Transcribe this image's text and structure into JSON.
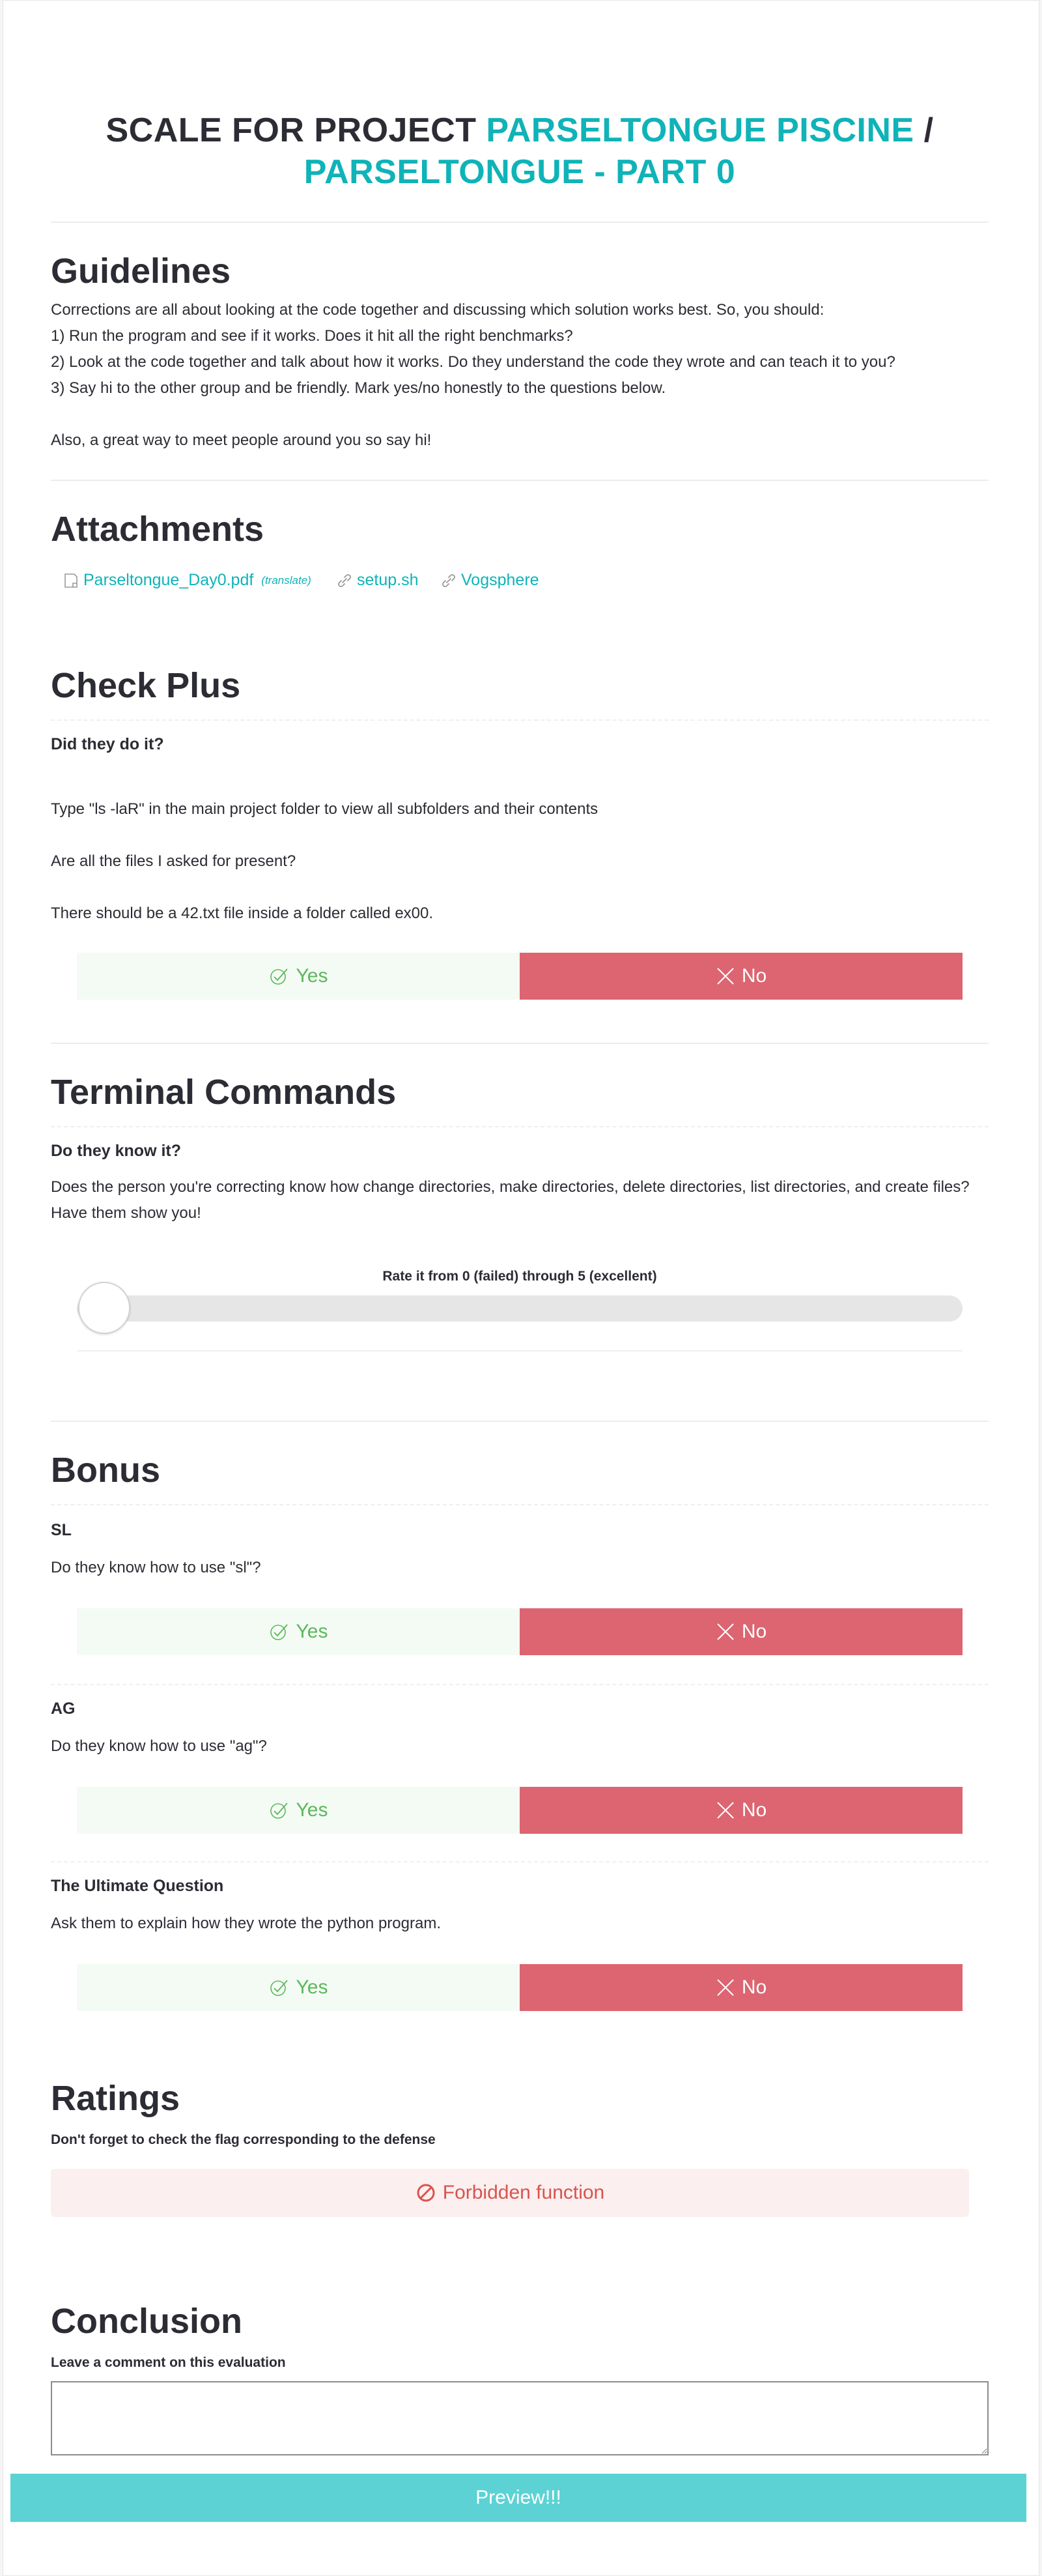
{
  "title": {
    "prefix": "SCALE FOR PROJECT",
    "name_line1": "PARSELTONGUE PISCINE",
    "slash": "/",
    "name_line2": "PARSELTONGUE - PART 0"
  },
  "guidelines": {
    "heading": "Guidelines",
    "lines": [
      "Corrections are all about looking at the code together and discussing which solution works best. So, you should:",
      "1) Run the program and see if it works. Does it hit all the right benchmarks?",
      "2) Look at the code together and talk about how it works. Do they understand the code they wrote and can teach it to you?",
      "3) Say hi to the other group and be friendly. Mark yes/no honestly to the questions below.",
      "",
      "Also, a great way to meet people around you so say hi!"
    ]
  },
  "attachments": {
    "heading": "Attachments",
    "items": [
      {
        "label": "Parseltongue_Day0.pdf",
        "extra": "(translate)",
        "icon": "document-icon"
      },
      {
        "label": "setup.sh",
        "icon": "link-icon"
      },
      {
        "label": "Vogsphere",
        "icon": "link-icon"
      }
    ]
  },
  "check_plus": {
    "heading": "Check Plus",
    "question": "Did they do it?",
    "lines": [
      "Type \"ls -laR\" in the main project folder to view all subfolders and their contents",
      "Are all the files I asked for present?",
      "There should be a 42.txt file inside a folder called ex00."
    ]
  },
  "terminal": {
    "heading": "Terminal Commands",
    "question": "Do they know it?",
    "lines": [
      "Does the person you're correcting know how change directories, make directories, delete directories, list directories, and create files?",
      "Have them show you!"
    ],
    "rate_label": "Rate it from 0 (failed) through 5 (excellent)",
    "rating_value": 0
  },
  "bonus": {
    "heading": "Bonus",
    "items": [
      {
        "question": "SL",
        "text": "Do they know how to use \"sl\"?"
      },
      {
        "question": "AG",
        "text": "Do they know how to use \"ag\"?"
      },
      {
        "question": "The Ultimate Question",
        "text": "Ask them to explain how they wrote the python program."
      }
    ]
  },
  "buttons": {
    "yes": "Yes",
    "no": "No"
  },
  "ratings": {
    "heading": "Ratings",
    "subtitle": "Don't forget to check the flag corresponding to the defense",
    "flag": "Forbidden function"
  },
  "conclusion": {
    "heading": "Conclusion",
    "subtitle": "Leave a comment on this evaluation",
    "comment_value": "",
    "preview": "Preview!!!"
  },
  "colors": {
    "teal": "#0fb3b8",
    "yes_bg": "#f4fbf4",
    "yes_text": "#5cb85c",
    "no_bg": "#dc6571",
    "preview_bg": "#5cd2d4",
    "forbidden_bg": "#fbefef",
    "forbidden_text": "#d9534f"
  }
}
